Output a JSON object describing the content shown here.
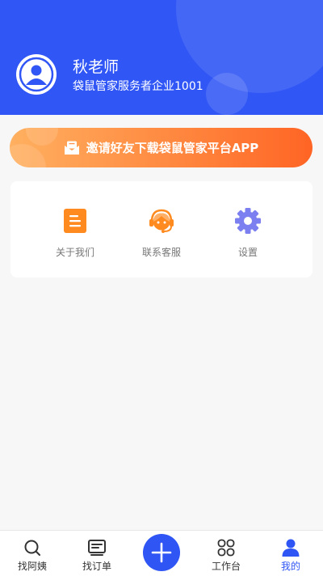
{
  "profile": {
    "name": "秋老师",
    "company": "袋鼠管家服务者企业1001"
  },
  "invite_banner": {
    "label": "邀请好友下载袋鼠管家平台APP",
    "icon": "envelope-icon"
  },
  "menu": [
    {
      "label": "关于我们",
      "icon": "document-icon",
      "color": "#ff8a1f"
    },
    {
      "label": "联系客服",
      "icon": "headset-icon",
      "color": "#ff8a1f"
    },
    {
      "label": "设置",
      "icon": "gear-icon",
      "color": "#7b7ff0"
    }
  ],
  "tabbar": {
    "items": [
      {
        "label": "找阿姨",
        "icon": "search-icon"
      },
      {
        "label": "找订单",
        "icon": "order-list-icon"
      },
      {
        "label": "工作台",
        "icon": "workbench-icon"
      },
      {
        "label": "我的",
        "icon": "person-icon"
      }
    ],
    "active": "我的",
    "add_icon": "plus-icon"
  },
  "colors": {
    "primary": "#3056f5",
    "active_tab": "#2f55f4",
    "orange": "#ff8a1f",
    "gear": "#7b7ff0"
  }
}
